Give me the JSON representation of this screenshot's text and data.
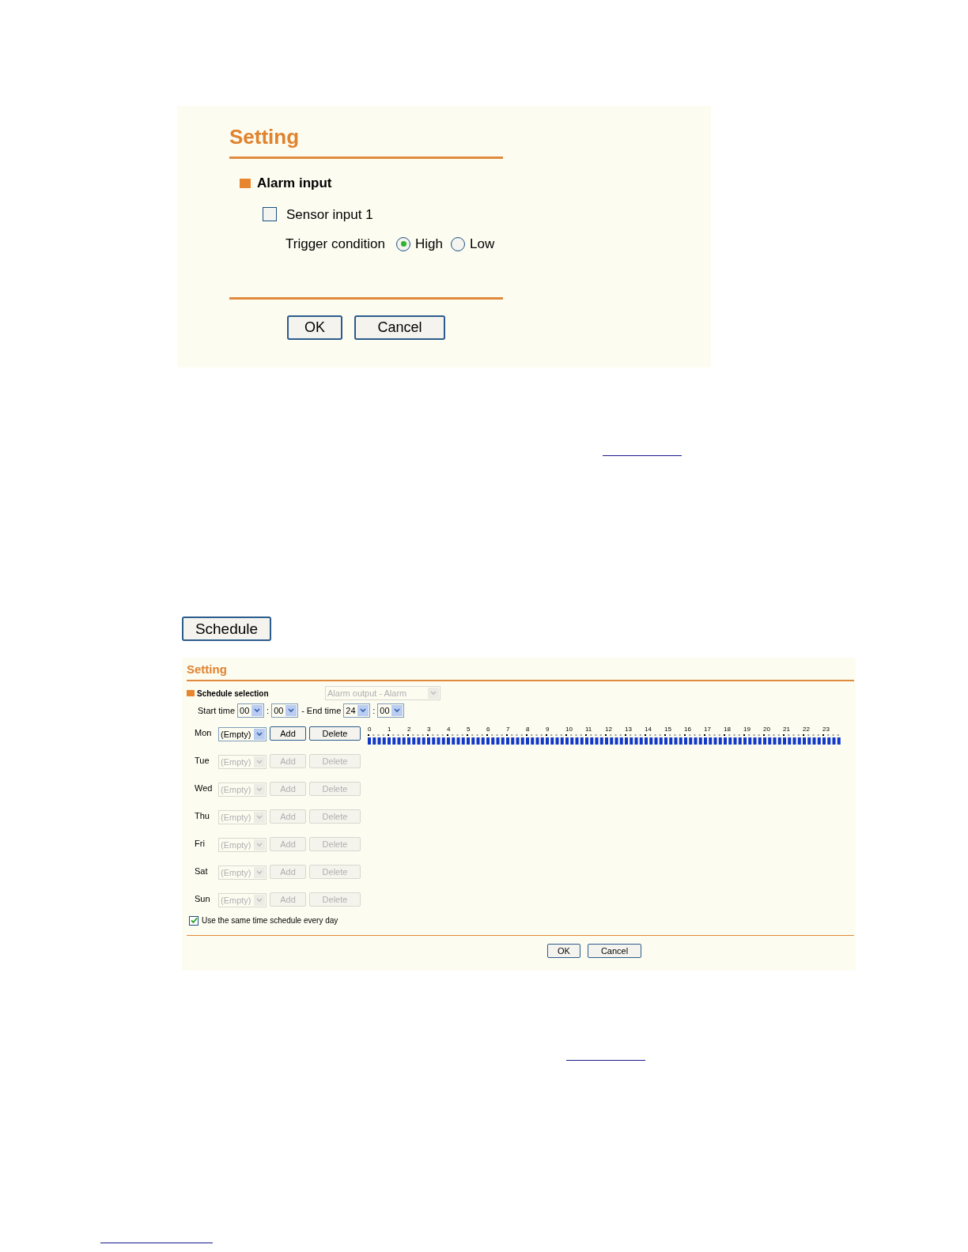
{
  "alarm_panel": {
    "title": "Setting",
    "section": "Alarm input",
    "sensor": {
      "label": "Sensor input 1",
      "checked": false
    },
    "trigger": {
      "label": "Trigger condition",
      "options": [
        {
          "label": "High",
          "selected": true
        },
        {
          "label": "Low",
          "selected": false
        }
      ]
    },
    "buttons": [
      "OK",
      "Cancel"
    ]
  },
  "schedule_button": "Schedule",
  "schedule_panel": {
    "title": "Setting",
    "section": "Schedule selection",
    "selection": {
      "value": "Alarm output - Alarm",
      "disabled": true
    },
    "times": [
      {
        "label": "Start time",
        "hour": "00",
        "separator": ":",
        "minute": "00"
      },
      {
        "label": "- End time",
        "hour": "24",
        "separator": ":",
        "minute": "00"
      }
    ],
    "days": [
      {
        "label": "Mon",
        "value": "(Empty)",
        "add": "Add",
        "delete": "Delete",
        "disabled": false
      },
      {
        "label": "Tue",
        "value": "(Empty)",
        "add": "Add",
        "delete": "Delete",
        "disabled": true
      },
      {
        "label": "Wed",
        "value": "(Empty)",
        "add": "Add",
        "delete": "Delete",
        "disabled": true
      },
      {
        "label": "Thu",
        "value": "(Empty)",
        "add": "Add",
        "delete": "Delete",
        "disabled": true
      },
      {
        "label": "Fri",
        "value": "(Empty)",
        "add": "Add",
        "delete": "Delete",
        "disabled": true
      },
      {
        "label": "Sat",
        "value": "(Empty)",
        "add": "Add",
        "delete": "Delete",
        "disabled": true
      },
      {
        "label": "Sun",
        "value": "(Empty)",
        "add": "Add",
        "delete": "Delete",
        "disabled": true
      }
    ],
    "hours": [
      "0",
      "1",
      "2",
      "3",
      "4",
      "5",
      "6",
      "7",
      "8",
      "9",
      "10",
      "11",
      "12",
      "13",
      "14",
      "15",
      "16",
      "17",
      "18",
      "19",
      "20",
      "21",
      "22",
      "23"
    ],
    "same_every_day": {
      "label": "Use the same time schedule every day",
      "checked": true
    },
    "buttons": [
      "OK",
      "Cancel"
    ]
  }
}
